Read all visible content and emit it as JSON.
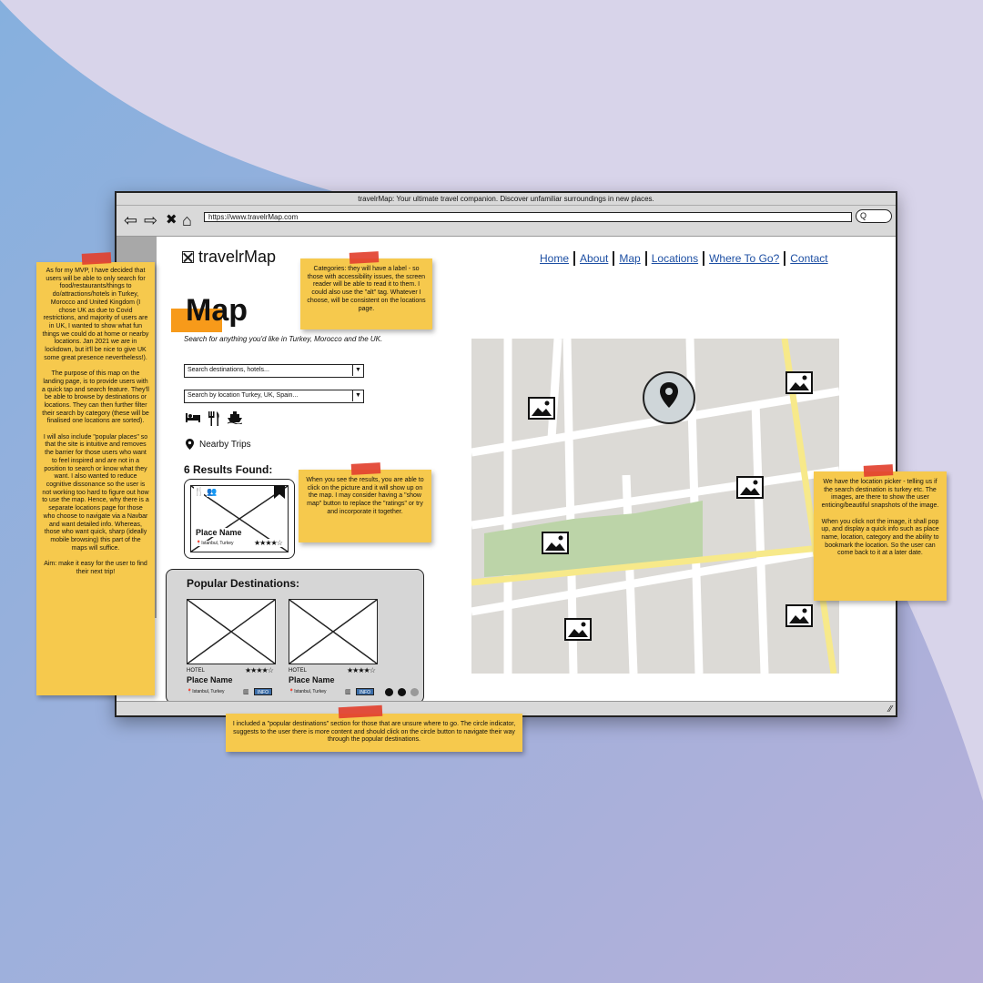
{
  "browser": {
    "title": "travelrMap: Your ultimate travel companion. Discover unfamiliar surroundings in new places.",
    "url": "https://www.travelrMap.com",
    "search_button": "Q"
  },
  "site": {
    "logo": "travelrMap",
    "nav": [
      "Home",
      "About",
      "Map",
      "Locations",
      "Where To Go?",
      "Contact"
    ]
  },
  "map_page": {
    "title": "Map",
    "subtitle": "Search for anything you'd like in Turkey, Morocco and the UK.",
    "search_destinations_placeholder": "Search destinations, hotels...",
    "search_location_placeholder": "Search by location Turkey, UK, Spain...",
    "category_icons": [
      "bed-icon",
      "restaurant-icon",
      "ship-icon"
    ],
    "nearby_label": "Nearby Trips",
    "results_label": "6 Results Found:",
    "result_card": {
      "name": "Place Name",
      "location": "Istanbul, Turkey",
      "rating": "★★★★☆"
    }
  },
  "popular": {
    "title": "Popular Destinations:",
    "items": [
      {
        "type": "HOTEL",
        "name": "Place Name",
        "location": "Istanbul, Turkey",
        "rating": "★★★★☆",
        "button": "INFO"
      },
      {
        "type": "HOTEL",
        "name": "Place Name",
        "location": "Istanbul, Turkey",
        "rating": "★★★★☆",
        "button": "INFO"
      }
    ]
  },
  "notes": {
    "mvp": "As for my MVP, I have decided that users will be able to only search for food/restaurants/things to do/attractions/hotels in Turkey, Morocco and United Kingdom (I chose UK as due to Covid restrictions, and majority of users are in UK, I wanted to show what fun things we could do at home or nearby locations. Jan 2021 we are in lockdown, but it'll be nice to give UK some great presence nevertheless!).\n\nThe purpose of this map on the landing page, is to provide users with a quick tap and search feature. They'll be able to browse by destinations or locations. They can then further filter their search by category (these will be finalised one locations are sorted).\n\nI will also include \"popular places\" so that the site is intuitive and removes the barrier for those users who want to feel inspired and are not in a position to search or know what they want. I also wanted to reduce cognitive dissonance so the user is not working too hard to figure out how to use the map. Hence, why there is a separate locations page for those who choose to navigate via a Navbar and want detailed info. Whereas, those who want quick, sharp (ideally mobile browsing) this part of the maps will suffice.\n\nAim: make it easy for the user to find their next trip!",
    "categories": "Categories: they will have a label - so those with accessibility issues, the screen reader will be able to read it to them. I could also use the \"alt\" tag. Whatever I choose, will be consistent on the locations page.",
    "results": "When you see the results, you are able to click on the picture and it will show up on the map. I may consider having a \"show map\" button to replace the \"ratings\" or try and incorporate it together.",
    "location_picker": "We have the location picker - telling us if the search destination is turkey etc. The images, are there to show the user enticing/beautiful snapshots of the image.\n\nWhen you click not the image, it shall pop up, and display a quick info such as place name, location, category and the ability to bookmark the location. So the user can come back to it at a later date.",
    "popular": "I included a \"popular destinations\" section for those that are unsure where to go. The circle indicator, suggests to the user there is more content and should click on the circle button to navigate their way through the popular destinations."
  },
  "colors": {
    "sticky": "#f6c94d",
    "tape": "#e2412f",
    "highlight": "#f79a1a",
    "link": "#1d4fa3",
    "map_park": "#bcd4a8",
    "map_main_road": "#f7e98a"
  }
}
